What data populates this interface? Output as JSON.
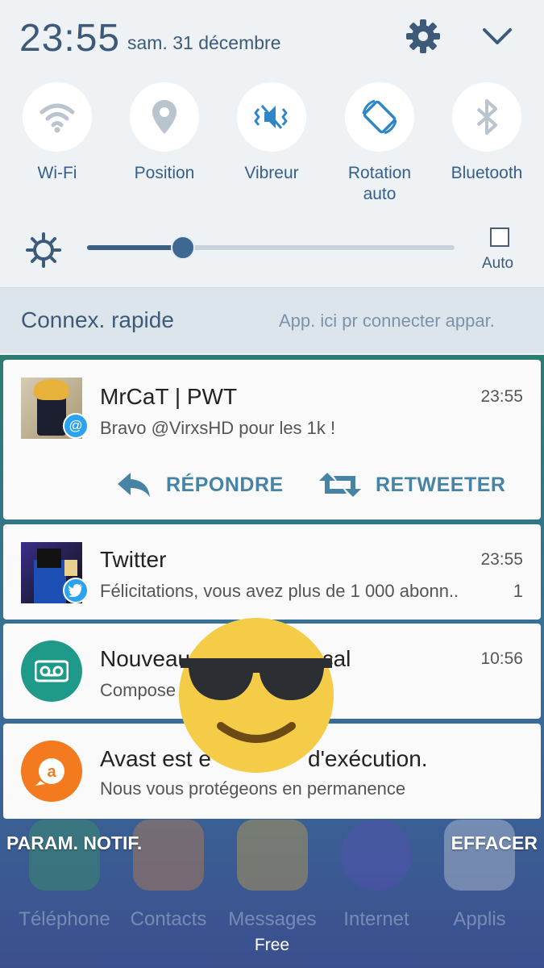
{
  "status": {
    "time": "23:55",
    "date": "sam. 31 décembre"
  },
  "toggles": [
    {
      "label": "Wi-Fi",
      "icon": "wifi-icon",
      "state": "off"
    },
    {
      "label": "Position",
      "icon": "location-pin-icon",
      "state": "off"
    },
    {
      "label": "Vibreur",
      "icon": "vibrate-icon",
      "state": "on"
    },
    {
      "label": "Rotation\nauto",
      "icon": "rotation-icon",
      "state": "on"
    },
    {
      "label": "Bluetooth",
      "icon": "bluetooth-icon",
      "state": "off"
    }
  ],
  "brightness": {
    "level": 0.26,
    "auto_label": "Auto",
    "auto_checked": false
  },
  "quick_connect": {
    "title": "Connex. rapide",
    "hint": "App. ici pr connecter appar."
  },
  "notifications": [
    {
      "title": "MrCaT | PWT",
      "body": "Bravo @VirxsHD pour les 1k !",
      "time": "23:55",
      "badge": "@",
      "actions": [
        "RÉPONDRE",
        "RETWEETER"
      ]
    },
    {
      "title": "Twitter",
      "body": "Félicitations, vous avez plus de 1 000 abonn..",
      "time": "23:55",
      "count": "1"
    },
    {
      "title": "Nouveau",
      "title_end": "ocal",
      "body": "Compose",
      "time": "10:56"
    },
    {
      "title": "Avast est e",
      "title_end": "d'exécution.",
      "body": "Nous vous protégeons en permanence"
    }
  ],
  "footer": {
    "notif_settings": "PARAM. NOTIF.",
    "clear": "EFFACER",
    "carrier": "Free"
  },
  "dock": [
    {
      "label": "Téléphone",
      "color": "#3aa35a"
    },
    {
      "label": "Contacts",
      "color": "#e08a3c"
    },
    {
      "label": "Messages",
      "color": "#e3b23a"
    },
    {
      "label": "Internet",
      "color": "#5b4fb8"
    },
    {
      "label": "Applis",
      "color": "#dfe3ea"
    }
  ],
  "colors": {
    "accent": "#3d5a78",
    "toggle_active": "#2f86c6",
    "action": "#4683a4",
    "twitter_blue": "#2aa3f0",
    "voicemail_green": "#1f9a8a",
    "avast_orange": "#f47a1f"
  }
}
